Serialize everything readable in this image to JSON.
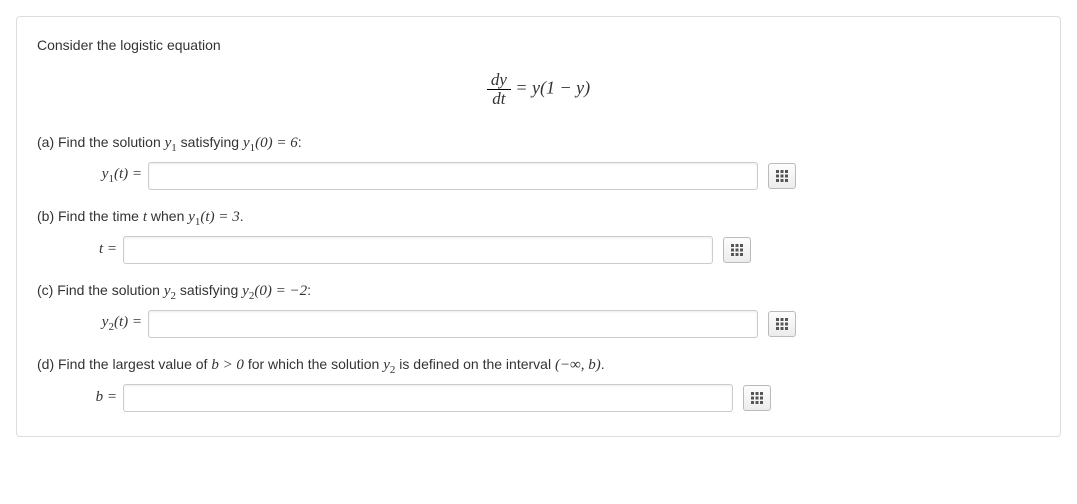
{
  "intro": "Consider the logistic equation",
  "equation": {
    "numerator": "dy",
    "denominator": "dt",
    "rhs": " = y(1 − y)"
  },
  "parts": {
    "a": {
      "prefix": "(a) Find the solution ",
      "y_expr": "y",
      "y_sub": "1",
      "middle": " satisfying ",
      "cond_y": "y",
      "cond_sub": "1",
      "cond_arg": "(0) = 6",
      "suffix": ":",
      "lhs_y": "y",
      "lhs_sub": "1",
      "lhs_arg": "(t) ="
    },
    "b": {
      "prefix": "(b) Find the time ",
      "t_var": "t",
      "middle": " when ",
      "y_expr": "y",
      "y_sub": "1",
      "y_arg": "(t) = 3",
      "suffix": ".",
      "lhs": "t ="
    },
    "c": {
      "prefix": "(c) Find the solution ",
      "y_expr": "y",
      "y_sub": "2",
      "middle": " satisfying ",
      "cond_y": "y",
      "cond_sub": "2",
      "cond_arg": "(0) = −2",
      "suffix": ":",
      "lhs_y": "y",
      "lhs_sub": "2",
      "lhs_arg": "(t) ="
    },
    "d": {
      "prefix": "(d) Find the largest value of ",
      "b_var": "b",
      "cond": " > 0",
      "middle": " for which the solution ",
      "y_expr": "y",
      "y_sub": "2",
      "middle2": " is defined on the interval ",
      "interval": "(−∞, b)",
      "suffix": ".",
      "lhs": "b ="
    }
  },
  "input_widths": {
    "a": 610,
    "b": 590,
    "c": 610,
    "d": 610
  }
}
